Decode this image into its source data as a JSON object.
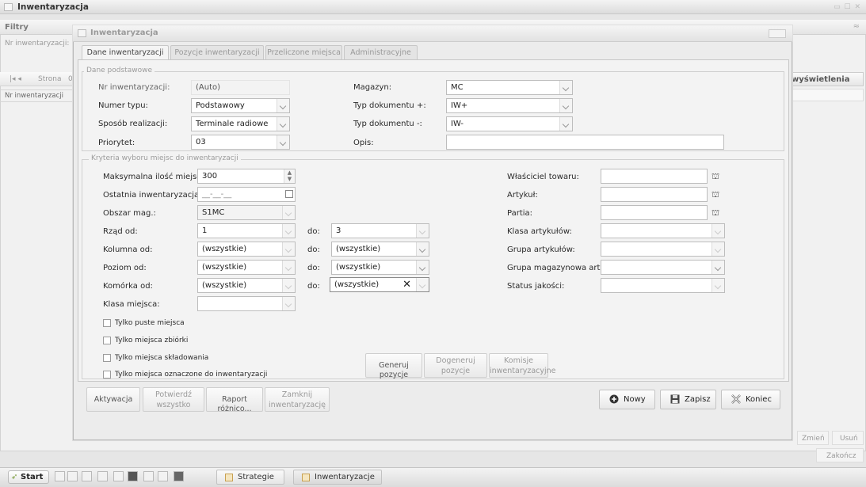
{
  "app": {
    "title": "Inwentaryzacja"
  },
  "filters": {
    "title": "Filtry",
    "nr_label": "Nr inwentaryzacji:",
    "pager_label": "Strona",
    "pager_value": "0",
    "column_nr": "Nr inwentaryzacji",
    "view_button": "wyświetlenia",
    "zmien": "Zmień",
    "usun": "Usuń",
    "zakoncz": "Zakończ"
  },
  "dialog": {
    "title": "Inwentaryzacja",
    "tabs": [
      "Dane inwentaryzacji",
      "Pozycje inwentaryzacji",
      "Przeliczone miejsca",
      "Administracyjne"
    ],
    "section_basic": "Dane podstawowe",
    "basic": {
      "nr_label": "Nr inwentaryzacji:",
      "nr_value": "(Auto)",
      "typ_label": "Numer typu:",
      "typ_value": "Podstawowy",
      "sposob_label": "Sposób realizacji:",
      "sposob_value": "Terminale radiowe",
      "priorytet_label": "Priorytet:",
      "priorytet_value": "03",
      "magazyn_label": "Magazyn:",
      "magazyn_value": "MC",
      "typ_plus_label": "Typ dokumentu +:",
      "typ_plus_value": "IW+",
      "typ_minus_label": "Typ dokumentu -:",
      "typ_minus_value": "IW-",
      "opis_label": "Opis:",
      "opis_value": ""
    },
    "section_criteria": "Kryteria wyboru miejsc do inwentaryzacji",
    "criteria": {
      "max_label": "Maksymalna ilość miejsc:",
      "max_value": "300",
      "ostatnia_label": "Ostatnia inwentaryzacja:",
      "ostatnia_value": "__-__-__",
      "obszar_label": "Obszar mag.:",
      "obszar_value": "S1MC",
      "rzad_label": "Rząd od:",
      "rzad_from": "1",
      "rzad_to": "3",
      "kolumna_label": "Kolumna od:",
      "kolumna_from": "(wszystkie)",
      "kolumna_to": "(wszystkie)",
      "poziom_label": "Poziom od:",
      "poziom_from": "(wszystkie)",
      "poziom_to": "(wszystkie)",
      "komorka_label": "Komórka od:",
      "komorka_from": "(wszystkie)",
      "komorka_to": "(wszystkie)",
      "klasa_label": "Klasa miejsca:",
      "klasa_value": "",
      "do_label": "do:",
      "wlasciciel_label": "Właściciel towaru:",
      "artykul_label": "Artykuł:",
      "partia_label": "Partia:",
      "klasa_art_label": "Klasa artykułów:",
      "grupa_art_label": "Grupa artykułów:",
      "grupa_mag_label": "Grupa magazynowa art.:",
      "status_label": "Status jakości:"
    },
    "checkboxes": [
      "Tylko puste miejsca",
      "Tylko miejsca zbiórki",
      "Tylko miejsca składowania",
      "Tylko miejsca oznaczone do inwentaryzacji"
    ],
    "gen_buttons": [
      {
        "line1": "Generuj pozycje",
        "line2": ""
      },
      {
        "line1": "Dogeneruj",
        "line2": "pozycje"
      },
      {
        "line1": "Komisje",
        "line2": "inwentaryzacyjne"
      }
    ],
    "footer_buttons": [
      {
        "line1": "Aktywacja",
        "line2": ""
      },
      {
        "line1": "Potwierdź",
        "line2": "wszystko"
      },
      {
        "line1": "Raport różnico...",
        "line2": ""
      },
      {
        "line1": "Zamknij",
        "line2": "inwentaryzację"
      }
    ],
    "nowy": "Nowy",
    "zapisz": "Zapisz",
    "koniec": "Koniec"
  },
  "taskbar": {
    "start": "Start",
    "tasks": [
      "Strategie",
      "Inwentaryzacje"
    ]
  }
}
